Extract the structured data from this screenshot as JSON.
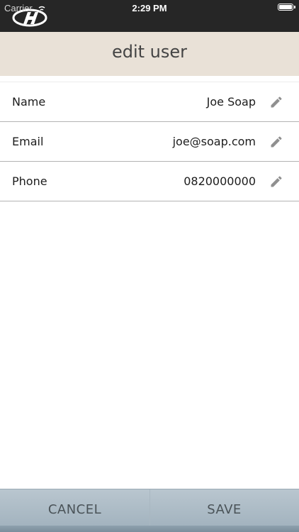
{
  "status_bar": {
    "carrier": "Carrier",
    "time": "2:29 PM",
    "logo_icon": "hyundai-logo",
    "battery_icon": "battery-full-icon"
  },
  "header": {
    "title": "edit user",
    "background": "#e9e1d7"
  },
  "fields": [
    {
      "label": "Name",
      "value": "Joe Soap",
      "icon": "pencil-icon"
    },
    {
      "label": "Email",
      "value": "joe@soap.com",
      "icon": "pencil-icon"
    },
    {
      "label": "Phone",
      "value": "0820000000",
      "icon": "pencil-icon"
    }
  ],
  "footer": {
    "cancel_label": "CANCEL",
    "save_label": "SAVE"
  },
  "colors": {
    "status_bar": "#262626",
    "footer": "#b9c6cf",
    "icon": "#8f8f8f"
  }
}
